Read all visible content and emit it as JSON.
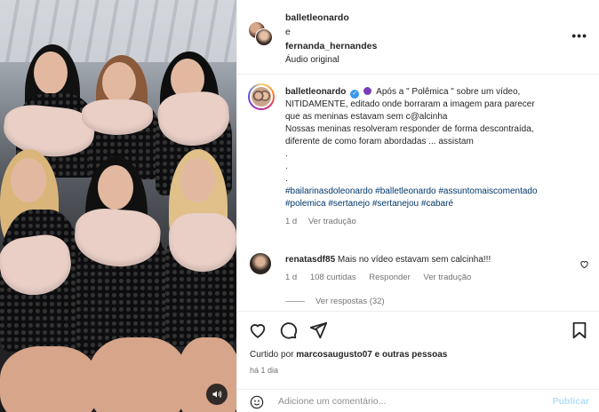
{
  "header": {
    "user1": "balletleonardo",
    "connector": "e",
    "user2": "fernanda_hernandes",
    "audio": "Áudio original",
    "more_icon": "more-horizontal-icon"
  },
  "caption": {
    "username": "balletleonardo",
    "line1": "Após a \" Polêmica \" sobre um vídeo,",
    "line2": "NITIDAMENTE, editado onde borraram a imagem para parecer",
    "line3": "que as meninas estavam sem c@alcinha",
    "line4": "Nossas meninas resolveram responder de forma descontraída,",
    "line5": "diferente de como foram abordadas ... assistam",
    "dots": [
      ".",
      ".",
      "."
    ],
    "tags1": "#bailarinasdoleonardo #balletleonardo #assuntomaiscomentado",
    "tags2": "#polemica #sertanejo #sertanejou #cabaré",
    "time": "1 d",
    "translate": "Ver tradução"
  },
  "comment": {
    "username": "renatasdf85",
    "text": "Mais no vídeo estavam sem calcinha!!!",
    "time": "1 d",
    "likes": "108 curtidas",
    "reply": "Responder",
    "translate": "Ver tradução",
    "view_replies": "Ver respostas (32)"
  },
  "footer": {
    "liked_prefix": "Curtido por",
    "liked_user": "marcosaugusto07",
    "liked_suffix": "e outras pessoas",
    "time": "há 1 dia",
    "comment_placeholder": "Adicione um comentário...",
    "publish": "Publicar"
  },
  "colors": {
    "link": "#00376b",
    "muted": "#737373",
    "publish_disabled": "#b2dffc",
    "verified": "#3897f0"
  }
}
